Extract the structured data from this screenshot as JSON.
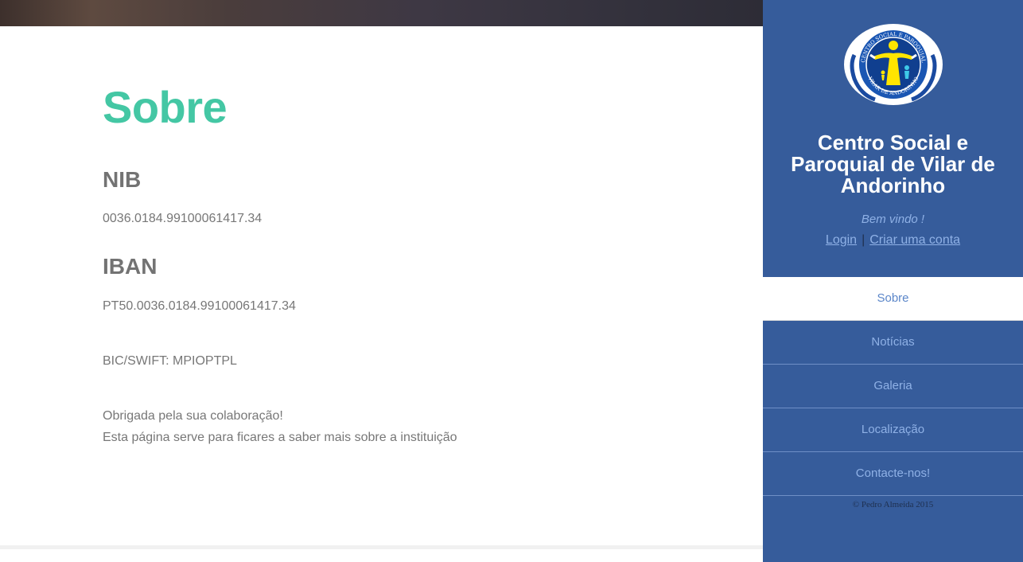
{
  "main": {
    "title": "Sobre",
    "sections": [
      {
        "heading": "NIB",
        "value": "0036.0184.99100061417.34"
      },
      {
        "heading": "IBAN",
        "value": "PT50.0036.0184.99100061417.34"
      }
    ],
    "bic": "BIC/SWIFT: MPIOPTPL",
    "thanks": "Obrigada pela sua colaboração!",
    "description": "Esta página serve para ficares a saber mais sobre a instituição"
  },
  "sidebar": {
    "logo_text_top": "CENTRO SOCIAL E PAROQUIAL",
    "logo_text_bottom": "VILAR DE ANDORINHO",
    "site_title_lines": [
      "Centro Social e",
      "Paroquial de Vilar de",
      "Andorinho"
    ],
    "welcome": "Bem vindo !",
    "login_label": "Login",
    "separator": "|",
    "register_label": "Criar uma conta",
    "nav": [
      {
        "label": "Sobre",
        "active": true
      },
      {
        "label": "Notícias",
        "active": false
      },
      {
        "label": "Galeria",
        "active": false
      },
      {
        "label": "Localização",
        "active": false
      },
      {
        "label": "Contacte-nos!",
        "active": false
      }
    ],
    "footer": "© Pedro Almeida 2015"
  },
  "colors": {
    "accent": "#44c7a4",
    "sidebar_bg": "#365c9b",
    "link": "#8fb1e6"
  }
}
